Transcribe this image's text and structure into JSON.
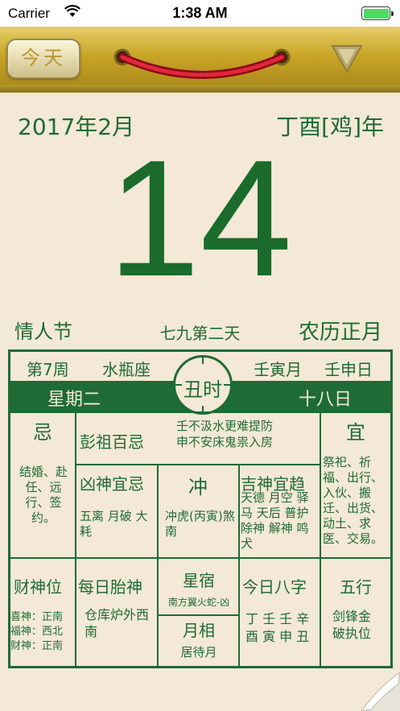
{
  "status_bar": {
    "carrier": "Carrier",
    "time": "1:38 AM"
  },
  "toolbar": {
    "today_label": "今天"
  },
  "header": {
    "month": "2017年2月",
    "ganzhi_year": "丁酉[鸡]年",
    "day": "14",
    "festival": "情人节",
    "solar_term": "七九第二天",
    "lunar_month": "农历正月"
  },
  "almanac": {
    "week": "第7周",
    "zodiac_sign": "水瓶座",
    "ganzhi_month": "壬寅月",
    "ganzhi_day": "壬申日",
    "hour": "丑时",
    "weekday": "星期二",
    "lunar_day": "十八日",
    "avoid_title": "忌",
    "avoid_items": "结婚、赴任、远行、签约。",
    "pengzu_title": "彭祖百忌",
    "pengzu_line1": "壬不汲水更难提防",
    "pengzu_line2": "申不安床鬼祟入房",
    "suitable_title": "宜",
    "suitable_items": "祭祀、祈福、出行、入伙、搬迁、出货、动土、求医、交易。",
    "evil_title": "凶神宜忌",
    "evil_items": "五离 月破 大耗",
    "clash_title": "冲",
    "clash_items": "冲虎(丙寅)煞南",
    "lucky_title": "吉神宜趋",
    "lucky_items": "天德 月空 驿马 天后 普护 除神 解神 鸣犬",
    "wealth_title": "财神位",
    "wealth_items": [
      "喜神：正南",
      "福神：西北",
      "财神：正南"
    ],
    "fetus_title": "每日胎神",
    "fetus_items": "仓库炉外西南",
    "star_title": "星宿",
    "star_items": "南方翼火蛇-凶",
    "moon_title": "月相",
    "moon_items": "居待月",
    "bazi_title": "今日八字",
    "bazi_row1": "丁 壬 壬 辛",
    "bazi_row2": "酉 寅 申 丑",
    "element_title": "五行",
    "element_items": "剑锋金破执位"
  },
  "colors": {
    "primary_green": "#1f6b35",
    "paper": "#f3e9d6",
    "gold": "#c9a526",
    "cord_red": "#c8102e"
  },
  "icons": {
    "wifi": "wifi-icon",
    "battery": "battery-icon",
    "dropdown": "triangle-down-icon",
    "cord": "hanging-cord-icon",
    "curl": "page-curl-icon"
  }
}
